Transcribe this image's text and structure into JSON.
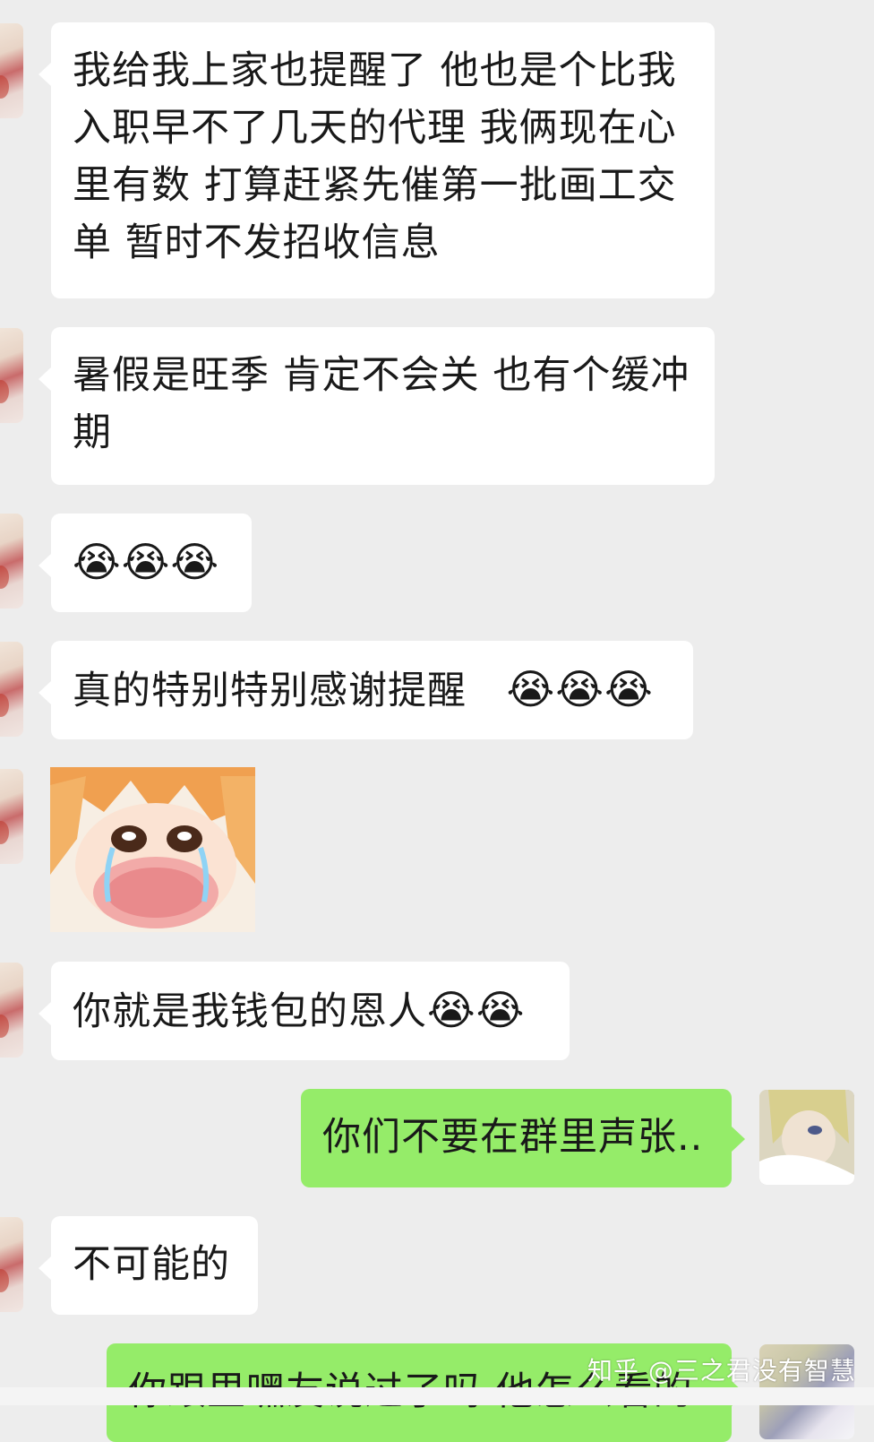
{
  "messages": [
    {
      "id": "m1",
      "side": "in",
      "text": "我给我上家也提醒了  他也是个比我入职早不了几天的代理 我俩现在心里有数 打算赶紧先催第一批画工交单 暂时不发招收信息"
    },
    {
      "id": "m2",
      "side": "in",
      "text": "暑假是旺季 肯定不会关 也有个缓冲期"
    },
    {
      "id": "m3",
      "side": "in",
      "emoji": "😭😭😭"
    },
    {
      "id": "m4",
      "side": "in",
      "text": "真的特别特别感谢提醒",
      "emoji": "😭😭😭"
    },
    {
      "id": "m5",
      "side": "in",
      "sticker": "crying-anime-girl"
    },
    {
      "id": "m6",
      "side": "in",
      "text": "你就是我钱包的恩人",
      "emoji": "😭😭"
    },
    {
      "id": "m7",
      "side": "out",
      "text": "你们不要在群里声张.."
    },
    {
      "id": "m8",
      "side": "in",
      "text": "不可能的"
    },
    {
      "id": "m9",
      "side": "out",
      "text": "你跟里嘿友说过了吗 他怎么看的"
    }
  ],
  "watermark": "知乎 @三之君没有智慧",
  "colors": {
    "background": "#ededed",
    "incoming": "#ffffff",
    "outgoing": "#95ec69"
  }
}
